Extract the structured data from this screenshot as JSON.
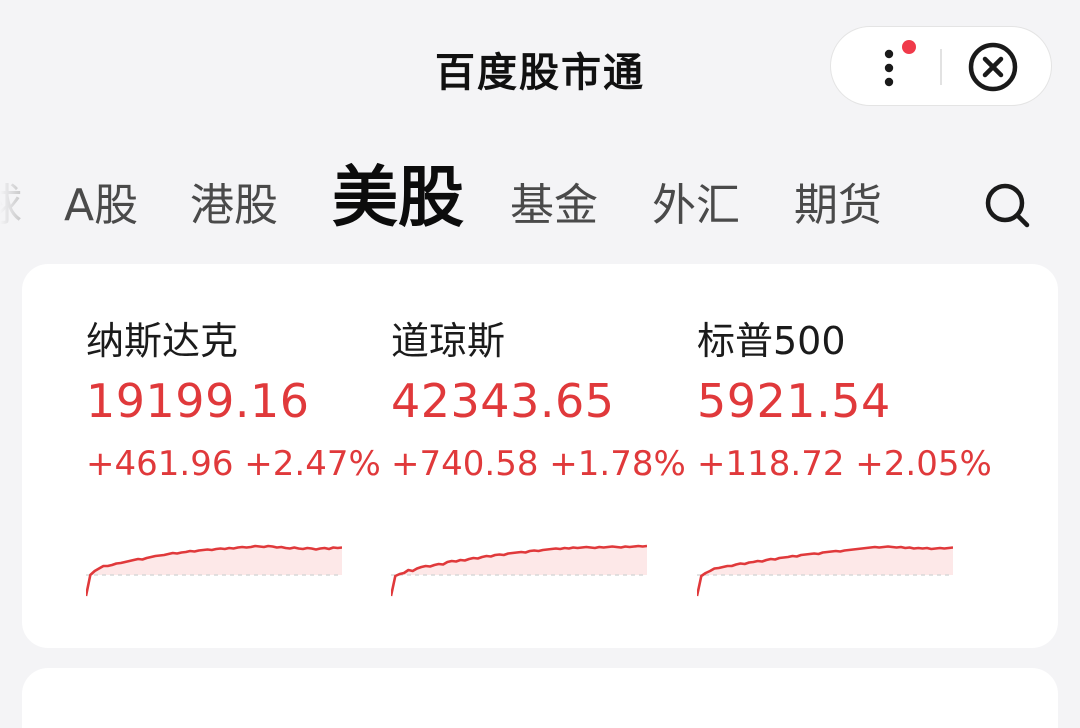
{
  "header": {
    "title": "百度股市通"
  },
  "tabs": [
    {
      "label": "球",
      "active": false,
      "partial": true
    },
    {
      "label": "A股",
      "active": false
    },
    {
      "label": "港股",
      "active": false
    },
    {
      "label": "美股",
      "active": true
    },
    {
      "label": "基金",
      "active": false
    },
    {
      "label": "外汇",
      "active": false
    },
    {
      "label": "期货",
      "active": false
    }
  ],
  "indices": [
    {
      "name": "纳斯达克",
      "price": "19199.16",
      "change": "+461.96 +2.47%",
      "trend": [
        0,
        0.42,
        0.5,
        0.55,
        0.6,
        0.6,
        0.62,
        0.65,
        0.66,
        0.68,
        0.7,
        0.72,
        0.74,
        0.73,
        0.76,
        0.78,
        0.8,
        0.81,
        0.82,
        0.84,
        0.86,
        0.85,
        0.87,
        0.88,
        0.9,
        0.89,
        0.91,
        0.92,
        0.93,
        0.92,
        0.94,
        0.95,
        0.94,
        0.96,
        0.95,
        0.97,
        0.98,
        0.97,
        0.98,
        1.0,
        0.99,
        0.98,
        1.0,
        0.99,
        0.97,
        0.98,
        0.96,
        0.95,
        0.97,
        0.95,
        0.94,
        0.96,
        0.95,
        0.93,
        0.95,
        0.96,
        0.94,
        0.97,
        0.96,
        0.97
      ]
    },
    {
      "name": "道琼斯",
      "price": "42343.65",
      "change": "+740.58 +1.78%",
      "trend": [
        0,
        0.4,
        0.44,
        0.46,
        0.52,
        0.5,
        0.55,
        0.58,
        0.6,
        0.59,
        0.62,
        0.64,
        0.63,
        0.68,
        0.7,
        0.69,
        0.72,
        0.71,
        0.74,
        0.76,
        0.75,
        0.78,
        0.8,
        0.79,
        0.82,
        0.83,
        0.82,
        0.85,
        0.86,
        0.87,
        0.88,
        0.87,
        0.9,
        0.91,
        0.9,
        0.92,
        0.93,
        0.94,
        0.95,
        0.94,
        0.96,
        0.95,
        0.97,
        0.96,
        0.97,
        0.98,
        0.97,
        0.96,
        0.98,
        0.97,
        0.98,
        0.99,
        0.98,
        0.97,
        0.99,
        0.98,
        0.99,
        1.0,
        0.99,
        1.0
      ]
    },
    {
      "name": "标普500",
      "price": "5921.54",
      "change": "+118.72 +2.05%",
      "trend": [
        0,
        0.4,
        0.46,
        0.5,
        0.55,
        0.56,
        0.58,
        0.6,
        0.6,
        0.63,
        0.65,
        0.64,
        0.67,
        0.68,
        0.7,
        0.69,
        0.72,
        0.74,
        0.73,
        0.76,
        0.77,
        0.78,
        0.8,
        0.79,
        0.82,
        0.83,
        0.84,
        0.85,
        0.84,
        0.87,
        0.88,
        0.89,
        0.9,
        0.89,
        0.91,
        0.92,
        0.93,
        0.94,
        0.95,
        0.96,
        0.97,
        0.98,
        0.97,
        0.98,
        0.99,
        0.98,
        0.97,
        0.98,
        0.96,
        0.97,
        0.95,
        0.96,
        0.95,
        0.96,
        0.94,
        0.95,
        0.96,
        0.95,
        0.96,
        0.97
      ]
    }
  ],
  "colors": {
    "rise": "#e0393b",
    "rise_fill": "#fde8e8",
    "baseline": "#d8d8d8",
    "notification_dot": "#f03a4a"
  },
  "icons": {
    "more": "vertical-ellipsis-icon",
    "close": "circle-x-icon",
    "search": "search-icon"
  }
}
